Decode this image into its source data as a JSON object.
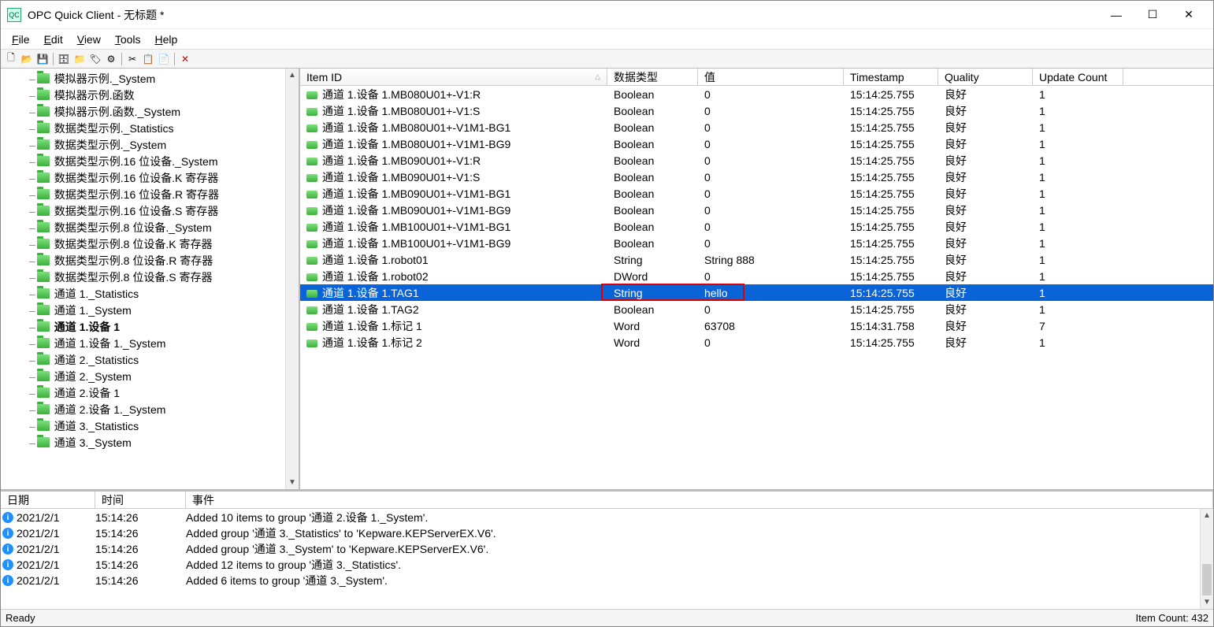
{
  "title": "OPC Quick Client - 无标题 *",
  "app_icon_text": "QC",
  "menus": {
    "file": "File",
    "edit": "Edit",
    "view": "View",
    "tools": "Tools",
    "help": "Help"
  },
  "tree": [
    {
      "label": "模拟器示例._System"
    },
    {
      "label": "模拟器示例.函数"
    },
    {
      "label": "模拟器示例.函数._System"
    },
    {
      "label": "数据类型示例._Statistics"
    },
    {
      "label": "数据类型示例._System"
    },
    {
      "label": "数据类型示例.16 位设备._System"
    },
    {
      "label": "数据类型示例.16 位设备.K 寄存器"
    },
    {
      "label": "数据类型示例.16 位设备.R 寄存器"
    },
    {
      "label": "数据类型示例.16 位设备.S 寄存器"
    },
    {
      "label": "数据类型示例.8 位设备._System"
    },
    {
      "label": "数据类型示例.8 位设备.K 寄存器"
    },
    {
      "label": "数据类型示例.8 位设备.R 寄存器"
    },
    {
      "label": "数据类型示例.8 位设备.S 寄存器"
    },
    {
      "label": "通道 1._Statistics"
    },
    {
      "label": "通道 1._System"
    },
    {
      "label": "通道 1.设备 1",
      "selected": true
    },
    {
      "label": "通道 1.设备 1._System"
    },
    {
      "label": "通道 2._Statistics"
    },
    {
      "label": "通道 2._System"
    },
    {
      "label": "通道 2.设备 1"
    },
    {
      "label": "通道 2.设备 1._System"
    },
    {
      "label": "通道 3._Statistics"
    },
    {
      "label": "通道 3._System"
    }
  ],
  "grid_headers": {
    "item_id": "Item ID",
    "data_type": "数据类型",
    "value": "值",
    "timestamp": "Timestamp",
    "quality": "Quality",
    "update_count": "Update Count"
  },
  "rows": [
    {
      "id": "通道 1.设备 1.MB080U01+-V1:R",
      "type": "Boolean",
      "val": "0",
      "ts": "15:14:25.755",
      "q": "良好",
      "uc": "1"
    },
    {
      "id": "通道 1.设备 1.MB080U01+-V1:S",
      "type": "Boolean",
      "val": "0",
      "ts": "15:14:25.755",
      "q": "良好",
      "uc": "1"
    },
    {
      "id": "通道 1.设备 1.MB080U01+-V1M1-BG1",
      "type": "Boolean",
      "val": "0",
      "ts": "15:14:25.755",
      "q": "良好",
      "uc": "1"
    },
    {
      "id": "通道 1.设备 1.MB080U01+-V1M1-BG9",
      "type": "Boolean",
      "val": "0",
      "ts": "15:14:25.755",
      "q": "良好",
      "uc": "1"
    },
    {
      "id": "通道 1.设备 1.MB090U01+-V1:R",
      "type": "Boolean",
      "val": "0",
      "ts": "15:14:25.755",
      "q": "良好",
      "uc": "1"
    },
    {
      "id": "通道 1.设备 1.MB090U01+-V1:S",
      "type": "Boolean",
      "val": "0",
      "ts": "15:14:25.755",
      "q": "良好",
      "uc": "1"
    },
    {
      "id": "通道 1.设备 1.MB090U01+-V1M1-BG1",
      "type": "Boolean",
      "val": "0",
      "ts": "15:14:25.755",
      "q": "良好",
      "uc": "1"
    },
    {
      "id": "通道 1.设备 1.MB090U01+-V1M1-BG9",
      "type": "Boolean",
      "val": "0",
      "ts": "15:14:25.755",
      "q": "良好",
      "uc": "1"
    },
    {
      "id": "通道 1.设备 1.MB100U01+-V1M1-BG1",
      "type": "Boolean",
      "val": "0",
      "ts": "15:14:25.755",
      "q": "良好",
      "uc": "1"
    },
    {
      "id": "通道 1.设备 1.MB100U01+-V1M1-BG9",
      "type": "Boolean",
      "val": "0",
      "ts": "15:14:25.755",
      "q": "良好",
      "uc": "1"
    },
    {
      "id": "通道 1.设备 1.robot01",
      "type": "String",
      "val": "String 888",
      "ts": "15:14:25.755",
      "q": "良好",
      "uc": "1"
    },
    {
      "id": "通道 1.设备 1.robot02",
      "type": "DWord",
      "val": "0",
      "ts": "15:14:25.755",
      "q": "良好",
      "uc": "1"
    },
    {
      "id": "通道 1.设备 1.TAG1",
      "type": "String",
      "val": "hello",
      "ts": "15:14:25.755",
      "q": "良好",
      "uc": "1",
      "selected": true,
      "highlight": true
    },
    {
      "id": "通道 1.设备 1.TAG2",
      "type": "Boolean",
      "val": "0",
      "ts": "15:14:25.755",
      "q": "良好",
      "uc": "1"
    },
    {
      "id": "通道 1.设备 1.标记 1",
      "type": "Word",
      "val": "63708",
      "ts": "15:14:31.758",
      "q": "良好",
      "uc": "7"
    },
    {
      "id": "通道 1.设备 1.标记 2",
      "type": "Word",
      "val": "0",
      "ts": "15:14:25.755",
      "q": "良好",
      "uc": "1"
    }
  ],
  "log_headers": {
    "date": "日期",
    "time": "时间",
    "event": "事件"
  },
  "log": [
    {
      "date": "2021/2/1",
      "time": "15:14:26",
      "event": "Added 10 items to group '通道 2.设备 1._System'."
    },
    {
      "date": "2021/2/1",
      "time": "15:14:26",
      "event": "Added group '通道 3._Statistics' to 'Kepware.KEPServerEX.V6'."
    },
    {
      "date": "2021/2/1",
      "time": "15:14:26",
      "event": "Added group '通道 3._System' to 'Kepware.KEPServerEX.V6'."
    },
    {
      "date": "2021/2/1",
      "time": "15:14:26",
      "event": "Added 12 items to group '通道 3._Statistics'."
    },
    {
      "date": "2021/2/1",
      "time": "15:14:26",
      "event": "Added 6 items to group '通道 3._System'."
    }
  ],
  "status": {
    "ready": "Ready",
    "item_count": "Item Count: 432"
  }
}
